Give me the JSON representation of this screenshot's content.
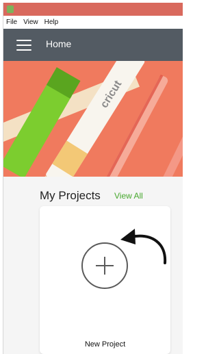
{
  "menu": {
    "items": [
      "File",
      "View",
      "Help"
    ]
  },
  "navbar": {
    "title": "Home",
    "menu_icon": "hamburger-menu-icon"
  },
  "hero": {
    "description_icon": "hero-banner-image"
  },
  "projects": {
    "title": "My Projects",
    "view_all_label": "View All",
    "new_project_label": "New Project",
    "plus_icon": "plus-circle-icon"
  },
  "colors": {
    "titlebar": "#d9695d",
    "navbar": "#535b63",
    "accent_green": "#47a82e",
    "hero_background": "#f07a5e"
  }
}
